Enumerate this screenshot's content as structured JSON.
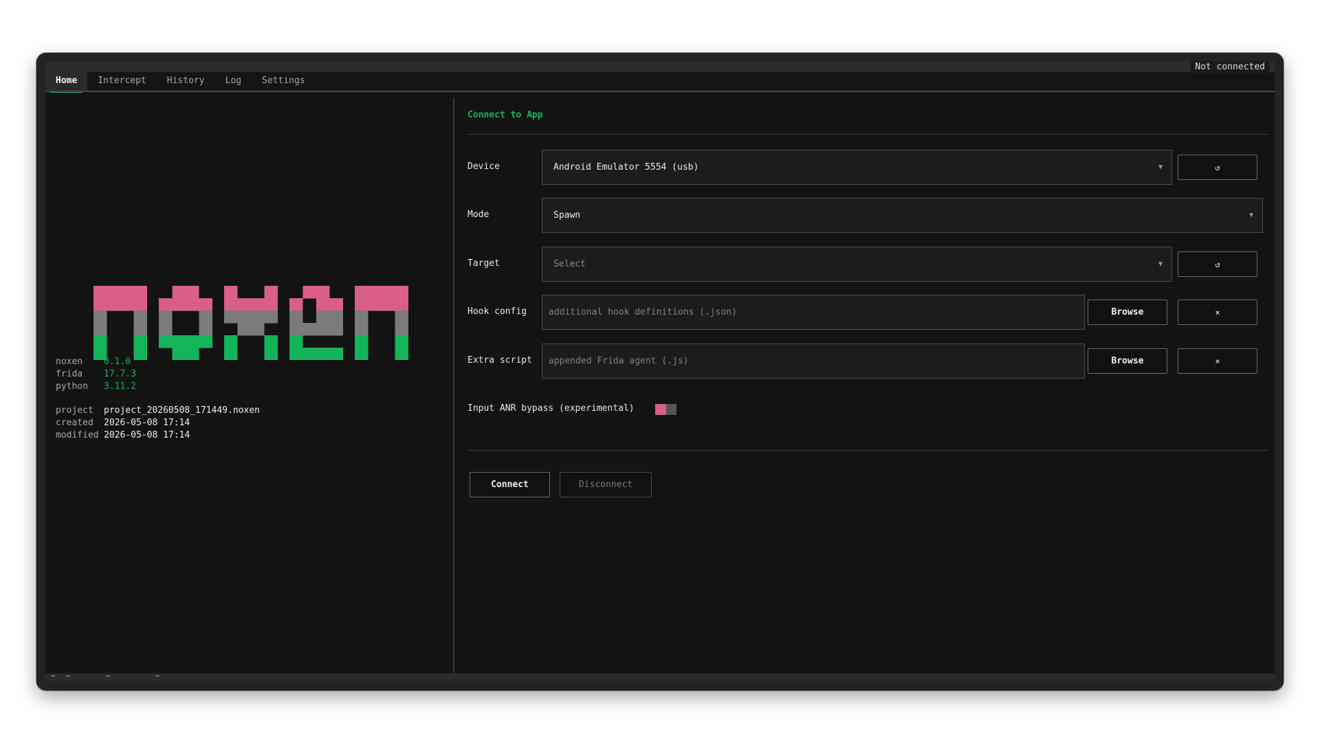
{
  "connection": {
    "status": "Not connected"
  },
  "tabs": [
    {
      "label": "Home",
      "active": true
    },
    {
      "label": "Intercept",
      "active": false
    },
    {
      "label": "History",
      "active": false
    },
    {
      "label": "Log",
      "active": false
    },
    {
      "label": "Settings",
      "active": false
    }
  ],
  "logo": {
    "text": "noxen",
    "colors": [
      "#d95f89",
      "#7b7b7b",
      "#13b45a"
    ]
  },
  "info": {
    "versions": [
      {
        "key": "noxen",
        "value": "0.1.0"
      },
      {
        "key": "frida",
        "value": "17.7.3"
      },
      {
        "key": "python",
        "value": "3.11.2"
      }
    ],
    "project": [
      {
        "key": "project",
        "value": "project_20260508_171449.noxen"
      },
      {
        "key": "created",
        "value": "2026-05-08 17:14"
      },
      {
        "key": "modified",
        "value": "2026-05-08 17:14"
      }
    ]
  },
  "connect": {
    "title": "Connect to App",
    "device": {
      "label": "Device",
      "value": "Android Emulator 5554  (usb)",
      "refresh_label": "↺"
    },
    "mode": {
      "label": "Mode",
      "value": "Spawn"
    },
    "target": {
      "label": "Target",
      "placeholder": "Select",
      "refresh_label": "↺"
    },
    "hook_config": {
      "label": "Hook config",
      "placeholder": "additional hook definitions (.json)",
      "browse_label": "Browse",
      "clear_label": "×"
    },
    "extra_script": {
      "label": "Extra script",
      "placeholder": "appended Frida agent (.js)",
      "browse_label": "Browse",
      "clear_label": "×"
    },
    "anr_bypass": {
      "label": "Input ANR bypass (experimental)",
      "enabled": false
    },
    "connect_label": "Connect",
    "disconnect_label": "Disconnect"
  },
  "colors": {
    "accent": "#13b45a",
    "pink": "#d95f89",
    "background": "#131313"
  }
}
